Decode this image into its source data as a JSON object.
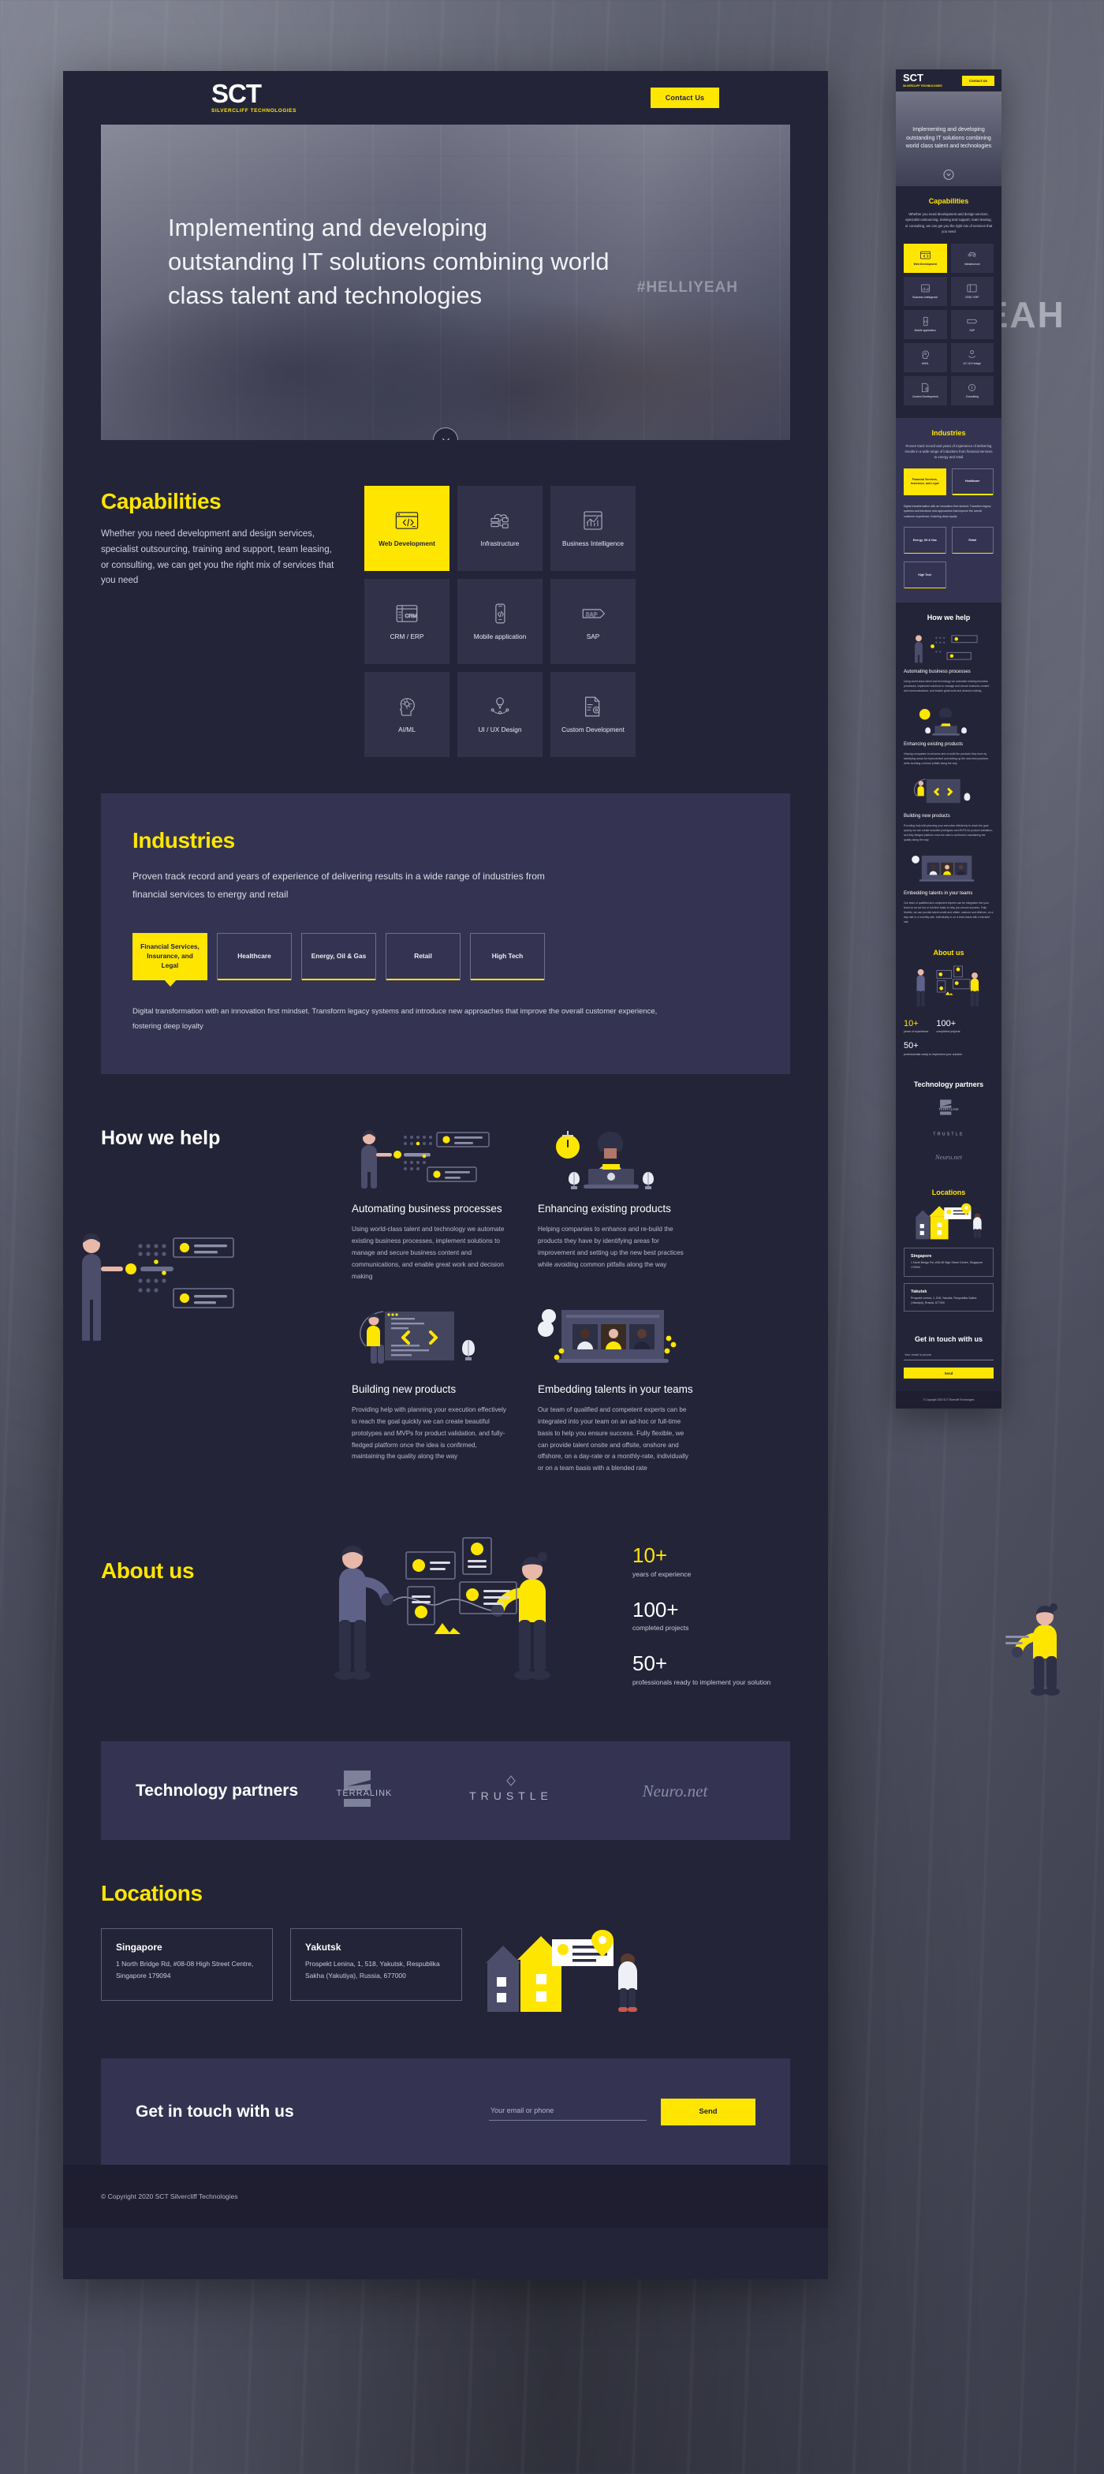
{
  "brand": {
    "logo_main": "SCT",
    "logo_sub": "SILVERCLIFF TECHNOLOGIES",
    "accent_yellow": "#FFE600",
    "dark_navy": "#242438",
    "panel_navy": "#343452",
    "tile_navy": "#31314A",
    "footer_navy": "#1E1E30"
  },
  "header": {
    "contact_button": "Contact Us"
  },
  "hero": {
    "heading": "Implementing and developing outstanding IT solutions combining world class talent and technologies",
    "heading_mobile": "Implementing and developing outstanding IT solutions combining world class talent and technologies",
    "watermark": "#HELLIYEAH",
    "backdrop_text": "YEAH",
    "scroll_icon": "chevron-down-icon"
  },
  "capabilities": {
    "title": "Capabilities",
    "description": "Whether you need development and design services, specialist outsourcing, training and support, team leasing, or consulting, we can get you the right mix of services that you need",
    "description_mobile": "Whether you need development and design services, specialist outsourcing, training and support, team leasing, or consulting, we can get you the right mix of services that you need",
    "tiles": [
      {
        "label": "Web Development",
        "icon": "browser-code-icon",
        "active": true
      },
      {
        "label": "Infrastructure",
        "icon": "cloud-server-icon",
        "active": false
      },
      {
        "label": "Business Intelligence",
        "icon": "dashboard-chart-icon",
        "active": false
      },
      {
        "label": "CRM / ERP",
        "icon": "crm-window-icon",
        "active": false
      },
      {
        "label": "Mobile application",
        "icon": "phone-code-icon",
        "active": false
      },
      {
        "label": "SAP",
        "icon": "sap-logo-icon",
        "active": false
      },
      {
        "label": "AI/ML",
        "icon": "ai-head-icon",
        "active": false
      },
      {
        "label": "UI / UX Design",
        "icon": "pen-nib-icon",
        "active": false
      },
      {
        "label": "Custom Development",
        "icon": "document-gear-icon",
        "active": false
      }
    ]
  },
  "industries": {
    "title": "Industries",
    "description": "Proven track record and years of experience of delivering results in a wide range of industries from financial services to energy and retail",
    "tabs": [
      {
        "label": "Financial Services, Insurance, and Legal",
        "active": true
      },
      {
        "label": "Healthcare",
        "active": false
      },
      {
        "label": "Energy, Oil & Gas",
        "active": false
      },
      {
        "label": "Retail",
        "active": false
      },
      {
        "label": "High Tech",
        "active": false
      }
    ],
    "body": "Digital transformation with an innovation first mindset. Transform legacy systems and introduce new approaches that improve the overall customer experience, fostering deep loyalty"
  },
  "how_we_help": {
    "title": "How we help",
    "cards": [
      {
        "title": "Automating business processes",
        "text": "Using world-class talent and technology we automate existing business processes, implement solutions to manage and secure business content and communications, and enable great work and decision making",
        "illustration": "man-pointing-dashboard-illustration"
      },
      {
        "title": "Enhancing existing products",
        "text": "Helping companies to enhance and re-build the products they have by identifying areas for improvement and setting up the new best practices while avoiding common pitfalls along the way",
        "illustration": "person-laptop-stopwatch-illustration"
      },
      {
        "title": "Building new products",
        "text": "Providing help with planning your execution effectively to reach the goal quickly we can create beautiful prototypes and MVPs for product validation, and fully-fledged platform once the idea is confirmed, maintaining the quality along the way",
        "illustration": "developer-code-screen-illustration"
      },
      {
        "title": "Embedding talents in your teams",
        "text": "Our team of qualified and competent experts can be integrated into your team on an ad-hoc or full-time basis to help you ensure success. Fully flexible, we can provide talent onsite and offsite, onshore and offshore, on a day-rate or a monthly-rate, individually or on a team basis with a blended rate",
        "illustration": "video-call-team-illustration"
      }
    ]
  },
  "about": {
    "title": "About us",
    "illustration": "two-people-data-cards-illustration",
    "stats": [
      {
        "number": "10+",
        "label": "years of experience",
        "color": "#FFE600"
      },
      {
        "number": "100+",
        "label": "completed projects",
        "color": "#FFFFFF"
      },
      {
        "number": "50+",
        "label": "professionals ready to implement your solution",
        "color": "#FFFFFF"
      }
    ]
  },
  "partners": {
    "title": "Technology partners",
    "logos": [
      {
        "name": "TERRALINK",
        "icon": "terralink-logo"
      },
      {
        "name": "T R U S T L E",
        "icon": "trustle-logo"
      },
      {
        "name": "Neuro.net",
        "icon": "neuronet-logo"
      }
    ]
  },
  "locations": {
    "title": "Locations",
    "illustration": "house-map-pin-person-illustration",
    "offices": [
      {
        "city": "Singapore",
        "address": "1 North Bridge Rd, #08-08 High Street Centre, Singapore 179094"
      },
      {
        "city": "Yakutsk",
        "address": "Prospekt Lenina, 1, 518, Yakutsk, Respublika Sakha (Yakutiya), Russia, 677000"
      }
    ]
  },
  "get_in_touch": {
    "title": "Get in touch with us",
    "input_placeholder": "Your email or phone",
    "input_value": "",
    "send_button": "Send"
  },
  "footer": {
    "copyright": "© Copyright 2020 SCT Silvercliff Technologies"
  }
}
